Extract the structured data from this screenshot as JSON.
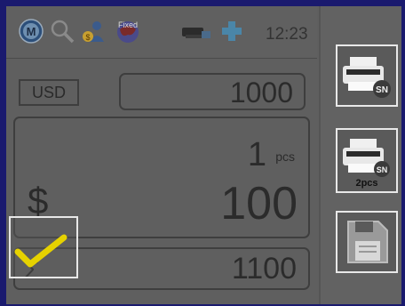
{
  "status": {
    "time": "12:23",
    "fixed_label": "Fixed",
    "icons": [
      "m-logo-icon",
      "search-icon",
      "user-coins-icon",
      "globe-fixed-icon",
      "printer-icon",
      "add-icon"
    ]
  },
  "currency": {
    "code": "USD"
  },
  "amount": {
    "value": "1000"
  },
  "count": {
    "pcs_value": "1",
    "pcs_unit": "pcs",
    "symbol": "$",
    "denomination": "100"
  },
  "total": {
    "symbol": "Σ",
    "value": "1100"
  },
  "right_buttons": [
    {
      "name": "print-sn",
      "badge": "SN"
    },
    {
      "name": "print-sn-2pcs",
      "badge": "SN",
      "sub": "2pcs"
    },
    {
      "name": "save"
    }
  ],
  "colors": {
    "accent": "#e6d200",
    "frame": "#1a1a6e"
  }
}
